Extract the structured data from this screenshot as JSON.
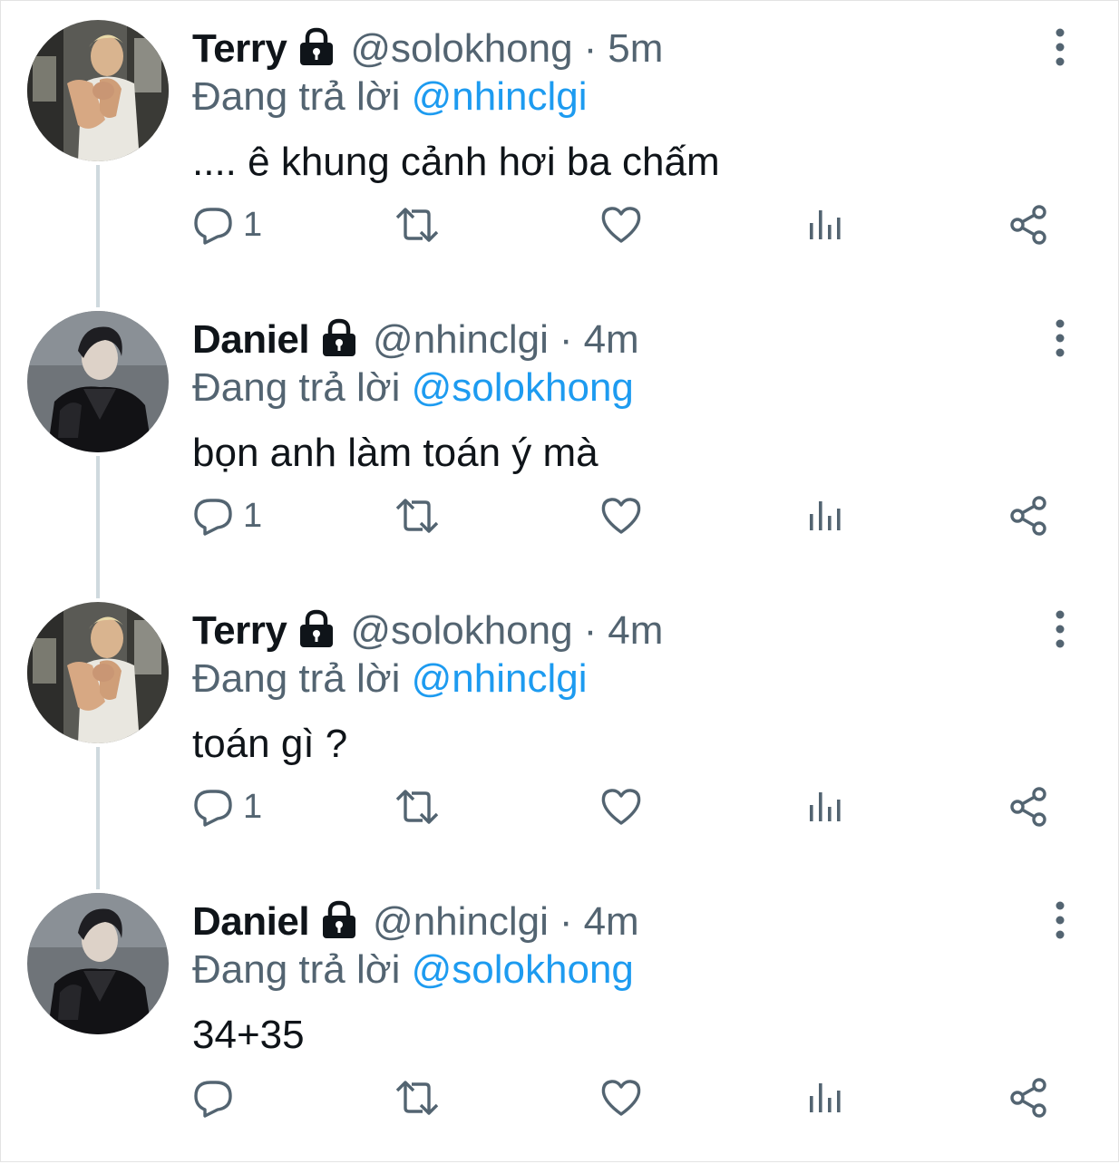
{
  "tweets": [
    {
      "name": "Terry",
      "handle": "@solokhong",
      "separator": "·",
      "time": "5m",
      "reply_prefix": "Đang trả lời",
      "reply_to": "@nhinclgi",
      "text": ".... ê khung cảnh hơi ba chấm",
      "reply_count": "1",
      "avatar": "terry"
    },
    {
      "name": "Daniel",
      "handle": "@nhinclgi",
      "separator": "·",
      "time": "4m",
      "reply_prefix": "Đang trả lời",
      "reply_to": "@solokhong",
      "text": "bọn anh làm toán ý mà",
      "reply_count": "1",
      "avatar": "daniel"
    },
    {
      "name": "Terry",
      "handle": "@solokhong",
      "separator": "·",
      "time": "4m",
      "reply_prefix": "Đang trả lời",
      "reply_to": "@nhinclgi",
      "text": "toán gì ?",
      "reply_count": "1",
      "avatar": "terry"
    },
    {
      "name": "Daniel",
      "handle": "@nhinclgi",
      "separator": "·",
      "time": "4m",
      "reply_prefix": "Đang trả lời",
      "reply_to": "@solokhong",
      "text": "34+35",
      "reply_count": "",
      "avatar": "daniel"
    }
  ],
  "icons": {
    "reply": "reply-icon",
    "retweet": "retweet-icon",
    "like": "heart-icon",
    "views": "views-icon",
    "share": "share-icon",
    "more": "more-vertical-icon",
    "lock": "lock-icon"
  },
  "colors": {
    "text": "#0f1419",
    "secondary": "#536471",
    "mention": "#1d9bf0",
    "thread_line": "#cfd9de"
  }
}
